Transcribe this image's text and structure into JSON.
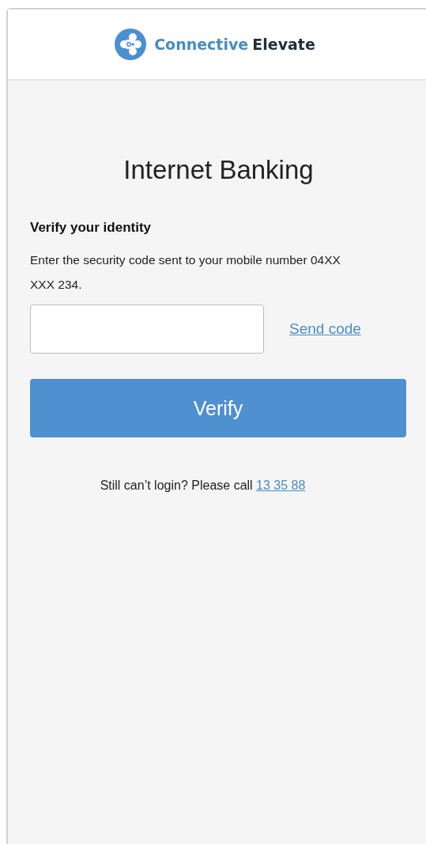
{
  "header": {
    "brand_first": "Connective",
    "brand_second": "Elevate"
  },
  "title": "Internet Banking",
  "heading": "Verify your identity",
  "instructions": "Enter the security code sent to your mobile number 04XX XXX 234.",
  "send_link": "Send code",
  "verify_button": "Verify",
  "help": {
    "text": "Still can’t login? Please call ",
    "phone_link": "13 35 88"
  }
}
